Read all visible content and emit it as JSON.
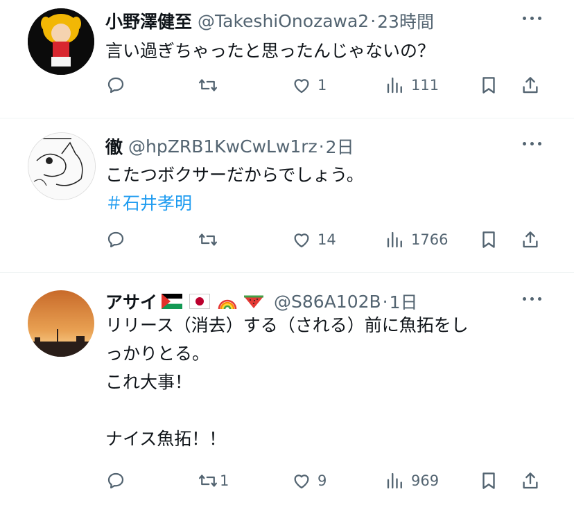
{
  "tweets": [
    {
      "name": "小野澤健至",
      "handle": "@TakeshiOnozawa2",
      "time": "23時間",
      "body": "言い過ぎちゃったと思ったんじゃないの？",
      "hashtag": "",
      "reply_count": "",
      "retweet_count": "",
      "like_count": "1",
      "view_count": "111"
    },
    {
      "name": "徹",
      "handle": "@hpZRB1KwCwLw1rz",
      "time": "2日",
      "body": "こたつボクサーだからでしょう。",
      "hashtag": "＃石井孝明",
      "reply_count": "",
      "retweet_count": "",
      "like_count": "14",
      "view_count": "1766"
    },
    {
      "name": "アサイ",
      "name_emoji": [
        "palestine-flag",
        "japan-flag",
        "rainbow",
        "watermelon"
      ],
      "handle": "@S86A102B",
      "time": "1日",
      "body": "リリース（消去）する（される）前に魚拓をし\nっかりとる。\nこれ大事！\n\nナイス魚拓！！",
      "hashtag": "",
      "reply_count": "",
      "retweet_count": "1",
      "like_count": "9",
      "view_count": "969"
    }
  ],
  "separator": "·",
  "colors": {
    "text": "#0f1419",
    "secondary": "#536471",
    "link": "#1d9bf0",
    "divider": "#eff3f4"
  },
  "icons": [
    "reply-icon",
    "retweet-icon",
    "like-icon",
    "views-icon",
    "bookmark-icon",
    "share-icon",
    "more-icon"
  ]
}
